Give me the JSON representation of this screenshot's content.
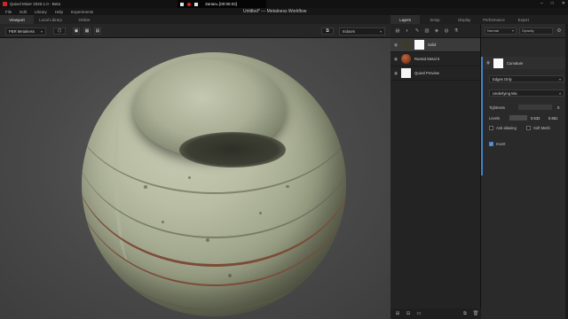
{
  "titlebar": {
    "app_title": "Quixel Mixer 2020.1.0 - Beta",
    "recording_label": "Запись [00:05:02]"
  },
  "menu": {
    "items": [
      "File",
      "Edit",
      "Library",
      "Help",
      "Experiments"
    ]
  },
  "document_title": "Untitled* — Metalness Workflow",
  "left_tabs": [
    "Viewport",
    "Local Library",
    "Online"
  ],
  "viewport_toolbar": {
    "render_mode": "PBR Metalness",
    "environment": "Indoors"
  },
  "right_tabs": [
    "Layers",
    "Setup",
    "Display",
    "Performance",
    "Export"
  ],
  "layers": [
    {
      "name": "Solid"
    },
    {
      "name": "Rusted Metal 5"
    },
    {
      "name": "Quixel Preview"
    }
  ],
  "layer_props": {
    "blend_mode": "Normal",
    "opacity_label": "Opacity"
  },
  "effect": {
    "name": "Curvature",
    "mode": "Edges Only",
    "source": "Underlying Mix",
    "tightness_label": "Tightness",
    "tightness_value": "0",
    "levels_label": "Levels",
    "levels_low": "0.532",
    "levels_high": "0.651",
    "antialiasing_label": "Anti-aliasing",
    "soft_mesh_label": "Soft Mesh",
    "invert_label": "Invert",
    "invert_checked": true
  },
  "colors": {
    "accent": "#3f83c8",
    "selected_row": "#3a3a3a",
    "rust_band": "#7b4b38"
  }
}
